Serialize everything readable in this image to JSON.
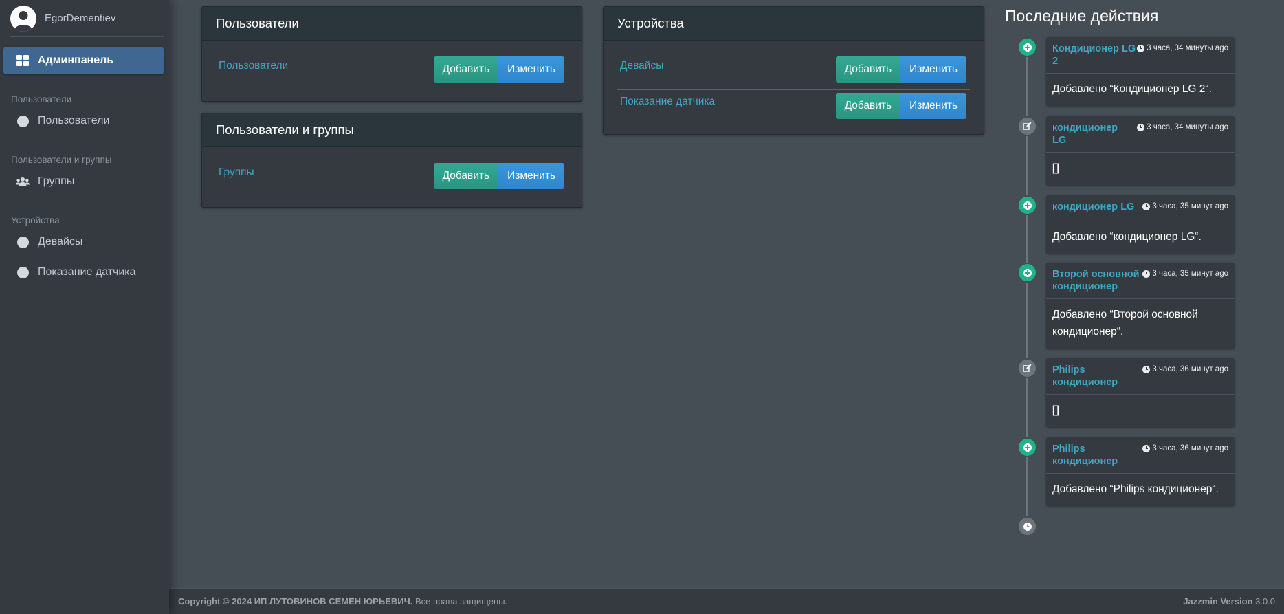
{
  "sidebar": {
    "username": "EgorDementiev",
    "active_item": "Админпанель",
    "sections": [
      {
        "header": "Пользователи",
        "items": [
          "Пользователи"
        ]
      },
      {
        "header": "Пользователи и группы",
        "items": [
          "Группы"
        ]
      },
      {
        "header": "Устройства",
        "items": [
          "Девайсы",
          "Показание датчика"
        ]
      }
    ]
  },
  "cards": {
    "users": {
      "title": "Пользователи",
      "rows": [
        {
          "label": "Пользователи",
          "add": "Добавить",
          "edit": "Изменить"
        }
      ]
    },
    "groups": {
      "title": "Пользователи и группы",
      "rows": [
        {
          "label": "Группы",
          "add": "Добавить",
          "edit": "Изменить"
        }
      ]
    },
    "devices": {
      "title": "Устройства",
      "rows": [
        {
          "label": "Девайсы",
          "add": "Добавить",
          "edit": "Изменить"
        },
        {
          "label": "Показание датчика",
          "add": "Добавить",
          "edit": "Изменить"
        }
      ]
    }
  },
  "timeline": {
    "title": "Последние действия",
    "items": [
      {
        "type": "add",
        "link": "Кондиционер LG 2",
        "time": "3 часа, 34 минуты ago",
        "body": "Добавлено “Кондиционер LG 2“."
      },
      {
        "type": "edit",
        "link": "кондиционер LG",
        "time": "3 часа, 34 минуты ago",
        "body": "[]"
      },
      {
        "type": "add",
        "link": "кондиционер LG",
        "time": "3 часа, 35 минут ago",
        "body": "Добавлено “кондиционер LG“."
      },
      {
        "type": "add",
        "link": "Второй основной кондиционер",
        "time": "3 часа, 35 минут ago",
        "body": "Добавлено “Второй основной кондиционер“."
      },
      {
        "type": "edit",
        "link": "Philips кондиционер",
        "time": "3 часа, 36 минут ago",
        "body": "[]"
      },
      {
        "type": "add",
        "link": "Philips кондиционер",
        "time": "3 часа, 36 минут ago",
        "body": "Добавлено “Philips кондиционер“."
      }
    ]
  },
  "footer": {
    "copyright": "Copyright © 2024 ИП ЛУТОВИНОВ СЕМЁН ЮРЬЕВИЧ.",
    "rights": "Все права защищены.",
    "version_label": "Jazzmin Version",
    "version": "3.0.0"
  }
}
